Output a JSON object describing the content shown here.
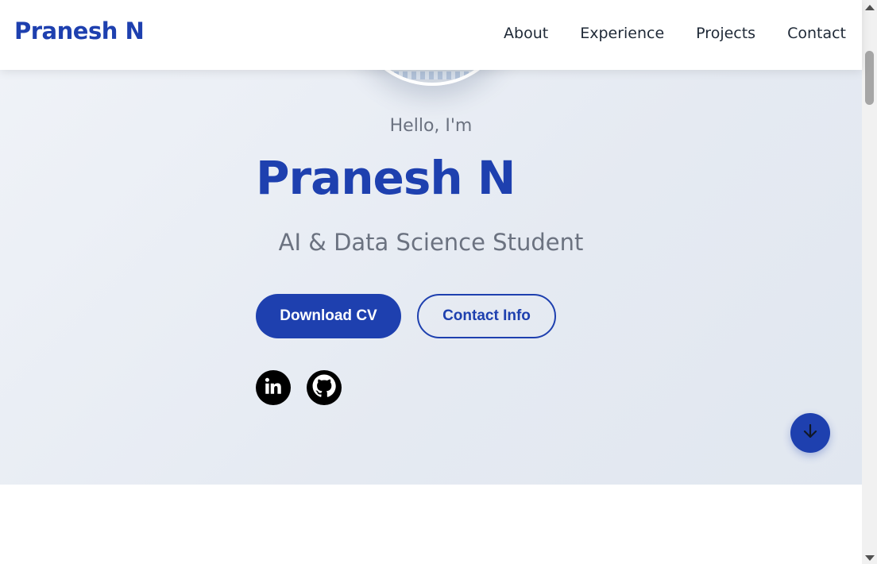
{
  "nav": {
    "brand": "Pranesh N",
    "links": [
      "About",
      "Experience",
      "Projects",
      "Contact"
    ]
  },
  "hero": {
    "greeting": "Hello, I'm",
    "name": "Pranesh N",
    "subtitle": "AI & Data Science Student",
    "buttons": {
      "download_cv": "Download CV",
      "contact_info": "Contact Info"
    },
    "social_icons": [
      "linkedin-icon",
      "github-icon"
    ],
    "scroll_icon": "arrow-down-icon"
  },
  "colors": {
    "accent": "#1e40af",
    "text_muted": "#6b7280",
    "nav_text": "#1f2937",
    "hero_bg": "#e8ecf3"
  }
}
